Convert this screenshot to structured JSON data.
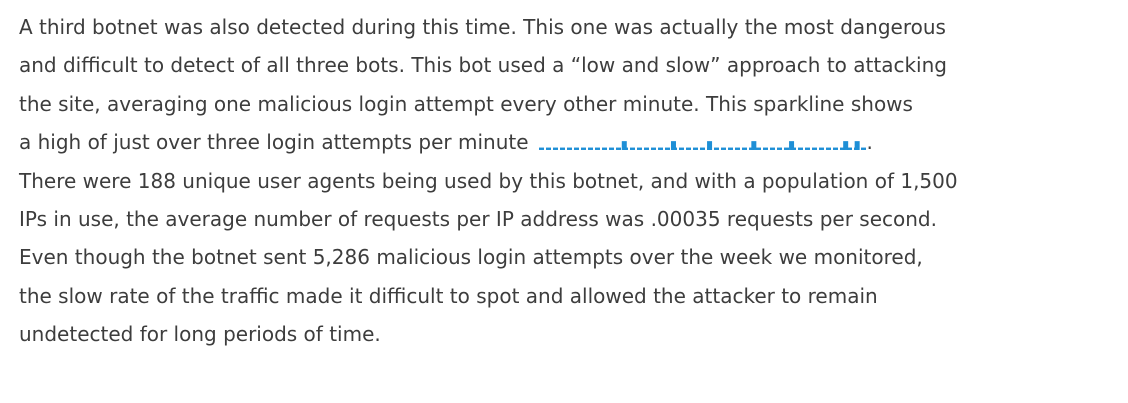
{
  "paragraph": {
    "lines": [
      "A third botnet was also detected during this time. This one was actually the most dangerous",
      "and difficult to detect of all three bots. This bot used a “low and slow” approach to attacking",
      "the site, averaging one malicious login attempt every other minute. This sparkline shows",
      "a high of just over three login attempts per minute",
      ".",
      "There were 188 unique user agents being used by this botnet, and with a population of 1,500",
      "IPs in use, the average number of requests per IP address was .00035 requests per second.",
      "Even though the botnet sent 5,286 malicious login attempts over the week we monitored,",
      "the slow rate of the traffic made it difficult to spot and allowed the attacker to remain",
      "undetected for long periods of time."
    ]
  },
  "sparkline": {
    "color": "#1e8fd6",
    "peak_value": 3.1,
    "baseline_value": 0.5,
    "peak_positions": [
      0.26,
      0.41,
      0.52,
      0.655,
      0.77,
      0.935,
      0.97
    ]
  }
}
